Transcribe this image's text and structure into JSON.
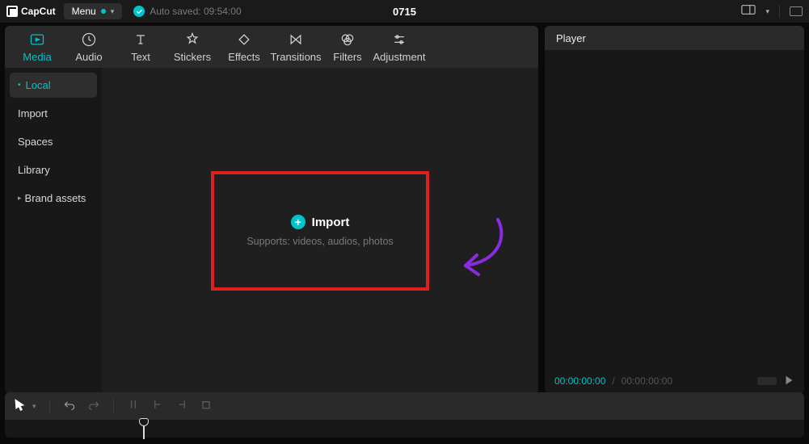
{
  "titlebar": {
    "brand": "CapCut",
    "menu_label": "Menu",
    "autosave_text": "Auto saved: 09:54:00",
    "project_title": "0715"
  },
  "tool_tabs": [
    {
      "key": "media",
      "label": "Media",
      "active": true
    },
    {
      "key": "audio",
      "label": "Audio",
      "active": false
    },
    {
      "key": "text",
      "label": "Text",
      "active": false
    },
    {
      "key": "stickers",
      "label": "Stickers",
      "active": false
    },
    {
      "key": "effects",
      "label": "Effects",
      "active": false
    },
    {
      "key": "transitions",
      "label": "Transitions",
      "active": false
    },
    {
      "key": "filters",
      "label": "Filters",
      "active": false
    },
    {
      "key": "adjustment",
      "label": "Adjustment",
      "active": false
    }
  ],
  "source_list": {
    "items": [
      {
        "label": "Local",
        "active": true,
        "indent": true,
        "collapsible": false
      },
      {
        "label": "Import",
        "active": false,
        "indent": false,
        "collapsible": false
      },
      {
        "label": "Spaces",
        "active": false,
        "indent": false,
        "collapsible": false
      },
      {
        "label": "Library",
        "active": false,
        "indent": false,
        "collapsible": false
      },
      {
        "label": "Brand assets",
        "active": false,
        "indent": false,
        "collapsible": true
      }
    ]
  },
  "import_drop": {
    "label": "Import",
    "supports": "Supports: videos, audios, photos"
  },
  "player": {
    "title": "Player",
    "timecode_current": "00:00:00:00",
    "timecode_total": "00:00:00:00",
    "separator": " / "
  },
  "annotation": {
    "highlight_color": "#e02020",
    "arrow_color": "#8a2be2"
  }
}
